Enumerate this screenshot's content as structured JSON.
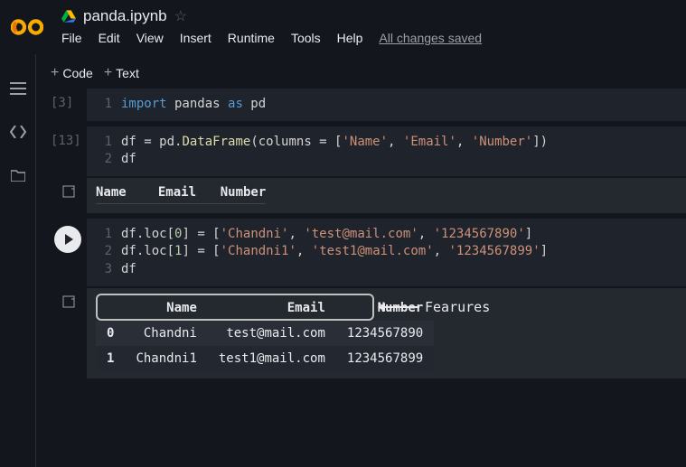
{
  "header": {
    "title": "panda.ipynb",
    "menu": {
      "file": "File",
      "edit": "Edit",
      "view": "View",
      "insert": "Insert",
      "runtime": "Runtime",
      "tools": "Tools",
      "help": "Help",
      "saved": "All changes saved"
    }
  },
  "toolbar": {
    "code": "Code",
    "text": "Text"
  },
  "cells": {
    "c1": {
      "exec": "[3]",
      "l1": {
        "ln": "1",
        "kw": "import",
        "mid": " pandas ",
        "as": "as",
        "end": " pd"
      }
    },
    "c2": {
      "exec": "[13]",
      "l1": {
        "ln": "1",
        "a": "df ",
        "eq": "=",
        "b": " pd.",
        "fn": "DataFrame",
        "c": "(columns ",
        "eq2": "=",
        "d": " [",
        "s1": "'Name'",
        "cm1": ", ",
        "s2": "'Email'",
        "cm2": ", ",
        "s3": "'Number'",
        "e": "])"
      },
      "l2": {
        "ln": "2",
        "a": "df"
      },
      "out_header": {
        "name": "Name",
        "email": "Email",
        "number": "Number"
      }
    },
    "c3": {
      "l1": {
        "ln": "1",
        "a": "df.loc[",
        "n": "0",
        "b": "] ",
        "eq": "=",
        "c": " [",
        "s1": "'Chandni'",
        "cm1": ", ",
        "s2": "'test@mail.com'",
        "cm2": ", ",
        "s3": "'1234567890'",
        "d": "]"
      },
      "l2": {
        "ln": "2",
        "a": "df.loc[",
        "n": "1",
        "b": "] ",
        "eq": "=",
        "c": " [",
        "s1": "'Chandni1'",
        "cm1": ", ",
        "s2": "'test1@mail.com'",
        "cm2": ", ",
        "s3": "'1234567899'",
        "d": "]"
      },
      "l3": {
        "ln": "3",
        "a": "df"
      },
      "out": {
        "headers": {
          "name": "Name",
          "email": "Email",
          "number": "Number"
        },
        "rows": [
          {
            "idx": "0",
            "name": "Chandni",
            "email": "test@mail.com",
            "number": "1234567890"
          },
          {
            "idx": "1",
            "name": "Chandni1",
            "email": "test1@mail.com",
            "number": "1234567899"
          }
        ]
      }
    }
  },
  "annotation": "Fearures"
}
